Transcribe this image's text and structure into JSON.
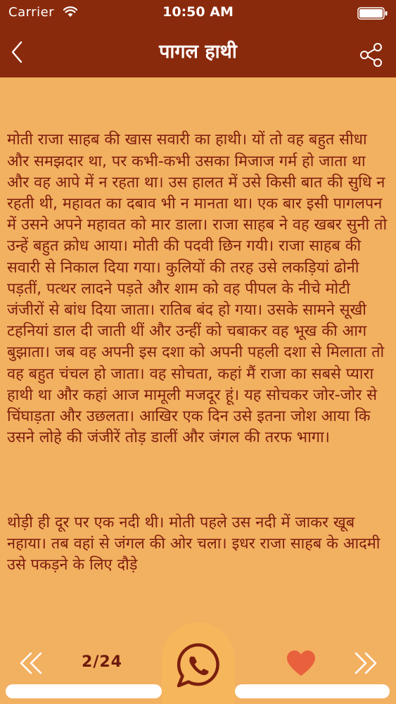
{
  "status_bar": {
    "carrier": "Carrier",
    "time": "10:50 AM"
  },
  "header": {
    "title": "पागल हाथी",
    "back_icon": "chevron-left-icon",
    "share_icon": "share-icon"
  },
  "story": {
    "paragraphs": [
      "मोती राजा साहब की खास सवारी का हाथी। यों तो वह बहुत सीधा और समझदार था, पर कभी-कभी उसका मिजाज गर्म हो जाता था और वह आपे में न रहता था। उस हालत में उसे किसी बात की सुधि न रहती थी, महावत का दबाव भी न मानता था। एक बार इसी पागलपन में उसने अपने महावत को मार डाला। राजा साहब ने वह खबर सुनी तो उन्हें बहुत क्रोध आया। मोती की पदवी छिन गयी। राजा साहब की सवारी से निकाल दिया गया। कुलियों की तरह उसे लकड़ियां ढोनी पड़तीं, पत्थर लादने पड़ते और शाम को वह पीपल के नीचे मोटी जंजीरों से बांध दिया जाता। रातिब बंद हो गया। उसके सामने सूखी टहनियां डाल दी जाती थीं और उन्हीं को चबाकर वह भूख की आग बुझाता। जब वह अपनी इस दशा को अपनी पहली दशा से मिलाता तो वह बहुत चंचल हो जाता। वह सोचता, कहां मैं राजा का सबसे प्यारा हाथी था और कहां आज मामूली मजदूर हूं। यह सोचकर जोर-जोर से चिंघाड़ता और उछलता। आखिर एक दिन उसे इतना जोश आया कि उसने लोहे की जंजीरें तोड़ डालीं और जंगल की तरफ भागा।",
      "थोड़ी ही दूर पर एक नदी थी। मोती पहले उस नदी में जाकर खूब नहाया। तब वहां से जंगल की ओर चला। इधर राजा साहब के आदमी उसे पकड़ने के लिए दौड़े"
    ]
  },
  "footer": {
    "page_counter": "2/24",
    "current_page": 2,
    "total_pages": 24,
    "prev_icon": "double-chevron-left-icon",
    "next_icon": "double-chevron-right-icon",
    "whatsapp_icon": "whatsapp-icon",
    "favorite_icon": "heart-icon"
  },
  "colors": {
    "header_bg": "#8a2a0c",
    "page_bg": "#f2b061",
    "text": "#7e1c0d",
    "heart": "#e8603c",
    "icon_dark": "#7a1f0e"
  }
}
